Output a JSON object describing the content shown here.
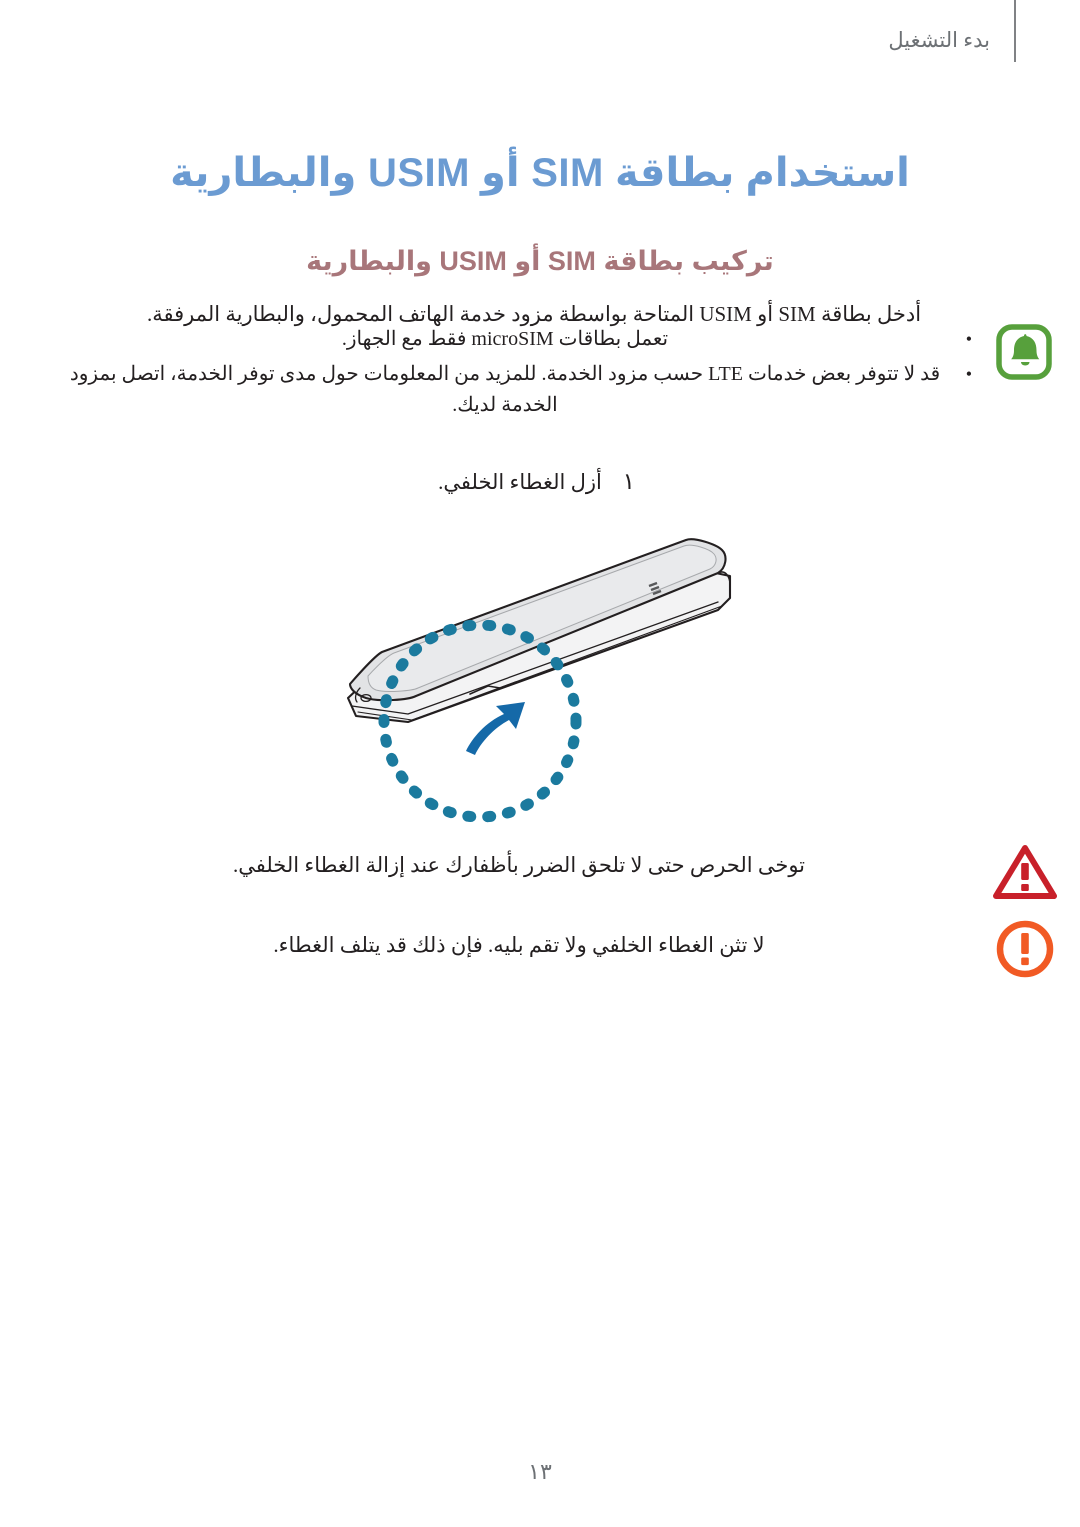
{
  "document": {
    "language": "ar",
    "page_number": "١٣"
  },
  "header": {
    "running_head": "بدء التشغيل",
    "rule_color": "#808285"
  },
  "titles": {
    "h1": "استخدام بطاقة SIM أو USIM والبطارية",
    "h1_color": "#6b9bd2",
    "h2": "تركيب بطاقة SIM أو USIM والبطارية",
    "h2_color": "#a8767a"
  },
  "body": {
    "intro": "أدخل بطاقة SIM أو USIM المتاحة بواسطة مزود خدمة الهاتف المحمول، والبطارية المرفقة."
  },
  "note": {
    "icon": "bell-icon",
    "icon_color": "#57a03c",
    "bullets": [
      "تعمل بطاقات microSIM فقط مع الجهاز.",
      "قد لا تتوفر بعض خدمات LTE حسب مزود الخدمة. للمزيد من المعلومات حول مدى توفر الخدمة، اتصل بمزود الخدمة لديك."
    ]
  },
  "step": {
    "number": "١",
    "text": "أزل الغطاء الخلفي."
  },
  "illustration": {
    "name": "phone-back-cover-removal",
    "device_fill": "#e2e3e5",
    "outline_color": "#231f20",
    "highlight_circle_color": "#1b7a9e",
    "arrow_color": "#1569a8"
  },
  "cautions": [
    {
      "icon": "warning-triangle-icon",
      "icon_color": "#c8202a",
      "text": "توخى الحرص حتى لا تلحق الضرر بأظفارك عند إزالة الغطاء الخلفي."
    },
    {
      "icon": "alert-circle-icon",
      "icon_color": "#f15a24",
      "text": "لا تثن الغطاء الخلفي ولا تقم بليه. فإن ذلك قد يتلف الغطاء."
    }
  ]
}
